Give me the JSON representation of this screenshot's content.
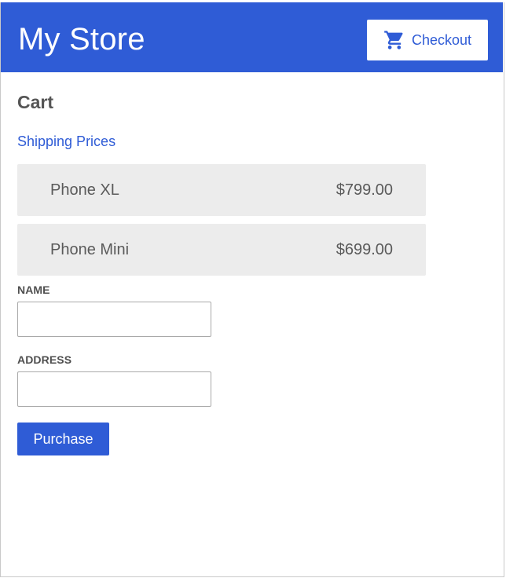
{
  "header": {
    "store_name": "My Store",
    "checkout_label": "Checkout",
    "checkout_icon": "shopping-cart-icon"
  },
  "cart": {
    "title": "Cart",
    "shipping_link": "Shipping Prices",
    "items": [
      {
        "name": "Phone XL",
        "price": "$799.00"
      },
      {
        "name": "Phone Mini",
        "price": "$699.00"
      }
    ]
  },
  "form": {
    "name_label": "NAME",
    "name_value": "",
    "address_label": "ADDRESS",
    "address_value": "",
    "purchase_label": "Purchase"
  },
  "colors": {
    "accent": "#2f5cd6",
    "item_background": "#ececec",
    "text": "#555555"
  }
}
